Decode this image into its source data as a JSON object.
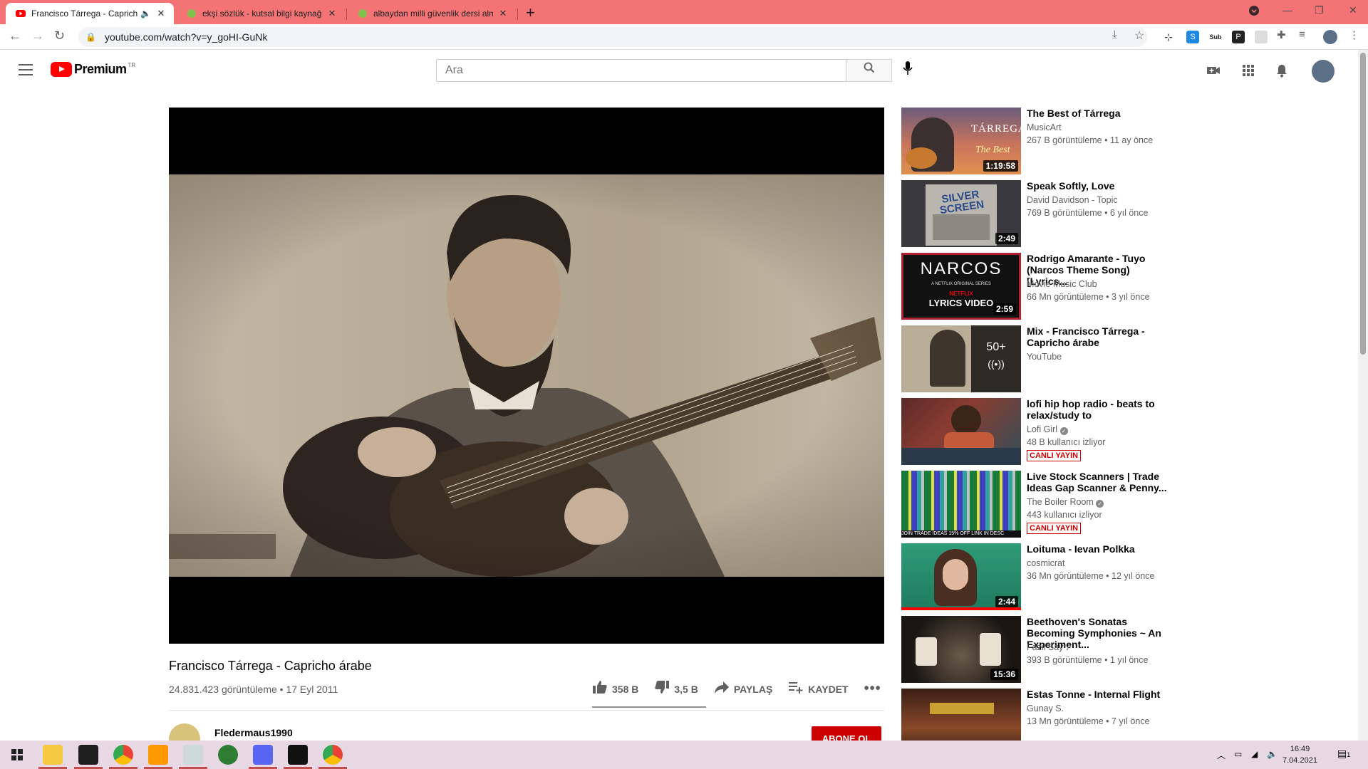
{
  "browser": {
    "tabs": [
      {
        "title": "Francisco Tárrega - Capricho",
        "active": true
      },
      {
        "title": "ekşi sözlük - kutsal bilgi kaynağı",
        "active": false
      },
      {
        "title": "albaydan milli güvenlik dersi alm",
        "active": false
      }
    ],
    "url": "youtube.com/watch?v=y_goHI-GuNk",
    "accent_color": "#f47476"
  },
  "youtube": {
    "logo_text": "Premium",
    "country_code": "TR",
    "search_placeholder": "Ara"
  },
  "video": {
    "title": "Francisco Tárrega - Capricho árabe",
    "views_date": "24.831.423 görüntüleme • 17 Eyl 2011",
    "likes": "358 B",
    "dislikes": "3,5 B",
    "share_label": "PAYLAŞ",
    "save_label": "KAYDET",
    "channel": "Fledermaus1990",
    "subscribe_label": "ABONE OL"
  },
  "recommendations": [
    {
      "title": "The Best of Tárrega",
      "channel": "MusicArt",
      "meta": "267 B görüntüleme • 11 ay önce",
      "duration": "1:19:58",
      "thumb_text": "TÁRREGA",
      "thumb_sub": "The Best"
    },
    {
      "title": "Speak Softly, Love",
      "channel": "David Davidson - Topic",
      "meta": "769 B görüntüleme • 6 yıl önce",
      "duration": "2:49",
      "thumb_text": "SILVER SCREEN"
    },
    {
      "title": "Rodrigo Amarante - Tuyo (Narcos Theme Song) [Lyrics...",
      "channel": "Movie Music Club",
      "meta": "66 Mn görüntüleme • 3 yıl önce",
      "duration": "2:59",
      "thumb_text": "NARCOS",
      "thumb_sub": "A NETFLIX ORIGINAL SERIES",
      "thumb_sub2": "NETFLIX",
      "thumb_sub3": "LYRICS VIDEO"
    },
    {
      "title": "Mix - Francisco Tárrega - Capricho árabe",
      "channel": "YouTube",
      "mix_count": "50+"
    },
    {
      "title": "lofi hip hop radio - beats to relax/study to",
      "channel": "Lofi Girl",
      "meta": "48 B kullanıcı izliyor",
      "live": "CANLI YAYIN"
    },
    {
      "title": "Live Stock Scanners | Trade Ideas Gap Scanner & Penny...",
      "channel": "The Boiler Room",
      "meta": "443 kullanıcı izliyor",
      "live": "CANLI YAYIN",
      "thumb_text": "JOIN TRADE IDEAS 15% OFF LINK IN DESC"
    },
    {
      "title": "Loituma - Ievan Polkka",
      "channel": "cosmicrat",
      "meta": "36 Mn görüntüleme • 12 yıl önce",
      "duration": "2:44"
    },
    {
      "title": "Beethoven's Sonatas Becoming Symphonies ~ An Experiment...",
      "channel": "Fazil Say",
      "meta": "393 B görüntüleme • 1 yıl önce",
      "duration": "15:36"
    },
    {
      "title": "Estas Tonne - Internal Flight",
      "channel": "Gunay S.",
      "meta": "13 Mn görüntüleme • 7 yıl önce"
    }
  ],
  "taskbar": {
    "time": "16:49",
    "date": "7.04.2021",
    "notif_count": "1"
  }
}
